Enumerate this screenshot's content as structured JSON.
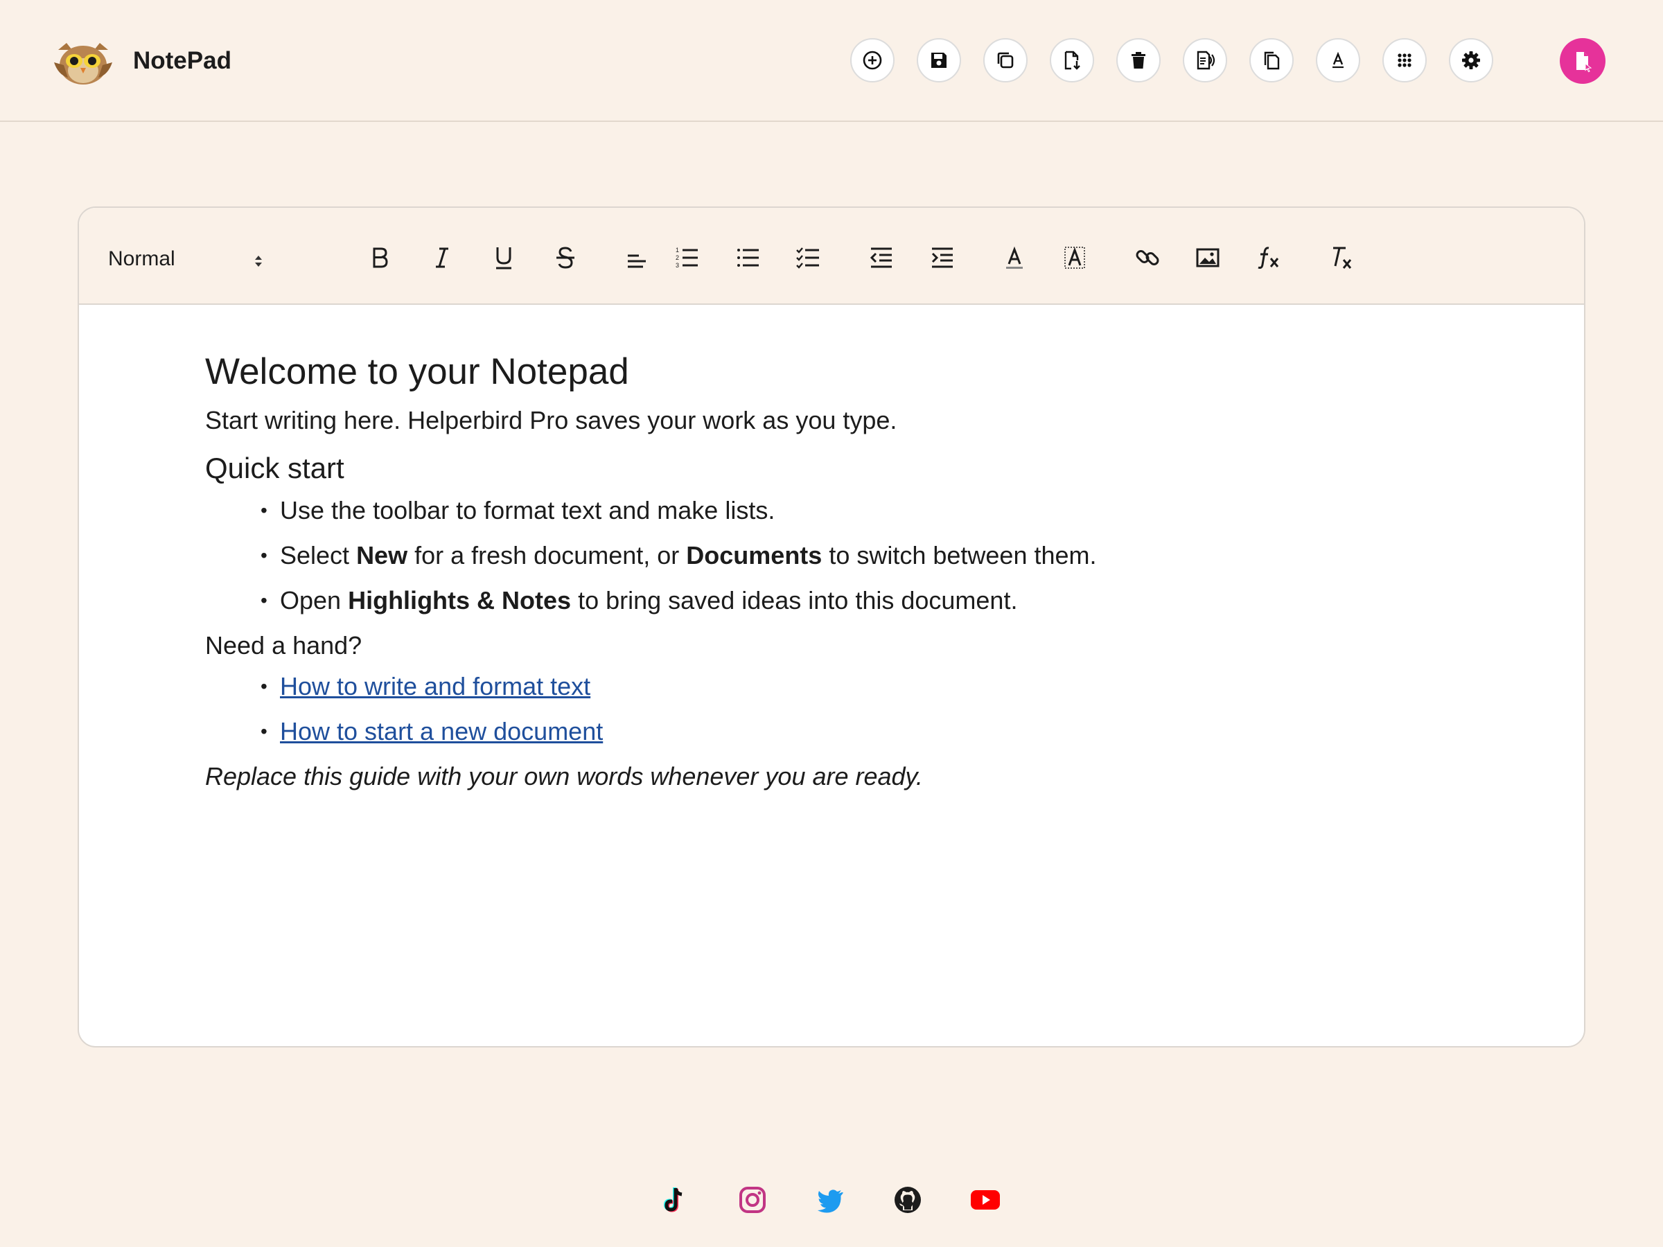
{
  "app": {
    "name": "NotePad"
  },
  "header": {
    "actions": [
      {
        "icon": "plus-circle-icon",
        "name": "new-document-button"
      },
      {
        "icon": "save-icon",
        "name": "save-button"
      },
      {
        "icon": "copy-icon",
        "name": "copy-button"
      },
      {
        "icon": "download-file-icon",
        "name": "download-button"
      },
      {
        "icon": "trash-icon",
        "name": "delete-button"
      },
      {
        "icon": "read-aloud-icon",
        "name": "read-aloud-button"
      },
      {
        "icon": "documents-icon",
        "name": "documents-button"
      },
      {
        "icon": "font-icon",
        "name": "font-button"
      },
      {
        "icon": "apps-grid-icon",
        "name": "apps-button"
      },
      {
        "icon": "gear-icon",
        "name": "settings-button"
      }
    ],
    "profile_icon": "highlights-notes-icon",
    "profile_color": "#e6329a"
  },
  "toolbar": {
    "format_select": "Normal",
    "tools": [
      {
        "icon": "bold-icon"
      },
      {
        "icon": "italic-icon"
      },
      {
        "icon": "underline-icon"
      },
      {
        "icon": "strikethrough-icon"
      },
      {
        "icon": "align-icon"
      },
      {
        "icon": "ordered-list-icon"
      },
      {
        "icon": "bullet-list-icon"
      },
      {
        "icon": "checklist-icon"
      },
      {
        "icon": "outdent-icon"
      },
      {
        "icon": "indent-icon"
      },
      {
        "icon": "text-color-icon"
      },
      {
        "icon": "highlight-color-icon"
      },
      {
        "icon": "link-icon"
      },
      {
        "icon": "image-icon"
      },
      {
        "icon": "formula-icon"
      },
      {
        "icon": "clear-format-icon"
      }
    ]
  },
  "document": {
    "title": "Welcome to your Notepad",
    "intro": "Start writing here. Helperbird Pro saves your work as you type.",
    "quick_start_heading": "Quick start",
    "quick_start": [
      {
        "text": "Use the toolbar to format text and make lists."
      },
      {
        "pre": "Select ",
        "bold1": "New",
        "mid": " for a fresh document, or ",
        "bold2": "Documents",
        "post": " to switch between them."
      },
      {
        "pre": "Open ",
        "bold": "Highlights & Notes",
        "post": " to bring saved ideas into this document."
      }
    ],
    "help_heading": "Need a hand?",
    "help_links": [
      "How to write and format text",
      "How to start a new document"
    ],
    "closing": "Replace this guide with your own words whenever you are ready."
  },
  "footer": {
    "social": [
      {
        "icon": "tiktok-icon",
        "color": "#111111"
      },
      {
        "icon": "instagram-icon",
        "color": "#c13584"
      },
      {
        "icon": "twitter-icon",
        "color": "#1d9bf0"
      },
      {
        "icon": "github-icon",
        "color": "#1c1c1c"
      },
      {
        "icon": "youtube-icon",
        "color": "#ff0000"
      }
    ]
  },
  "colors": {
    "background": "#faf1e8",
    "link": "#1f4f9c",
    "accent_pink": "#e6329a"
  }
}
